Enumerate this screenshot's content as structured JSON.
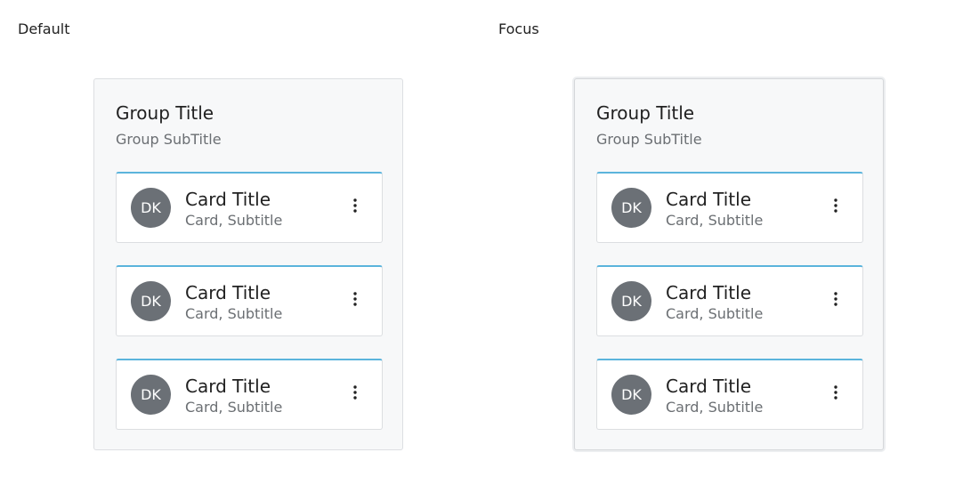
{
  "panels": [
    {
      "label": "Default",
      "group_title": "Group Title",
      "group_subtitle": "Group SubTitle",
      "cards": [
        {
          "avatar": "DK",
          "title": "Card Title",
          "subtitle": "Card, Subtitle",
          "menu_icon": "more-vertical-icon"
        },
        {
          "avatar": "DK",
          "title": "Card Title",
          "subtitle": "Card, Subtitle",
          "menu_icon": "more-vertical-icon"
        },
        {
          "avatar": "DK",
          "title": "Card Title",
          "subtitle": "Card, Subtitle",
          "menu_icon": "more-vertical-icon"
        }
      ]
    },
    {
      "label": "Focus",
      "group_title": "Group Title",
      "group_subtitle": "Group SubTitle",
      "cards": [
        {
          "avatar": "DK",
          "title": "Card Title",
          "subtitle": "Card, Subtitle",
          "menu_icon": "more-vertical-icon"
        },
        {
          "avatar": "DK",
          "title": "Card Title",
          "subtitle": "Card, Subtitle",
          "menu_icon": "more-vertical-icon"
        },
        {
          "avatar": "DK",
          "title": "Card Title",
          "subtitle": "Card, Subtitle",
          "menu_icon": "more-vertical-icon"
        }
      ]
    }
  ],
  "colors": {
    "card_accent": "#5bb4dc",
    "avatar_bg": "#6b7076",
    "group_bg": "#f7f8f9"
  }
}
